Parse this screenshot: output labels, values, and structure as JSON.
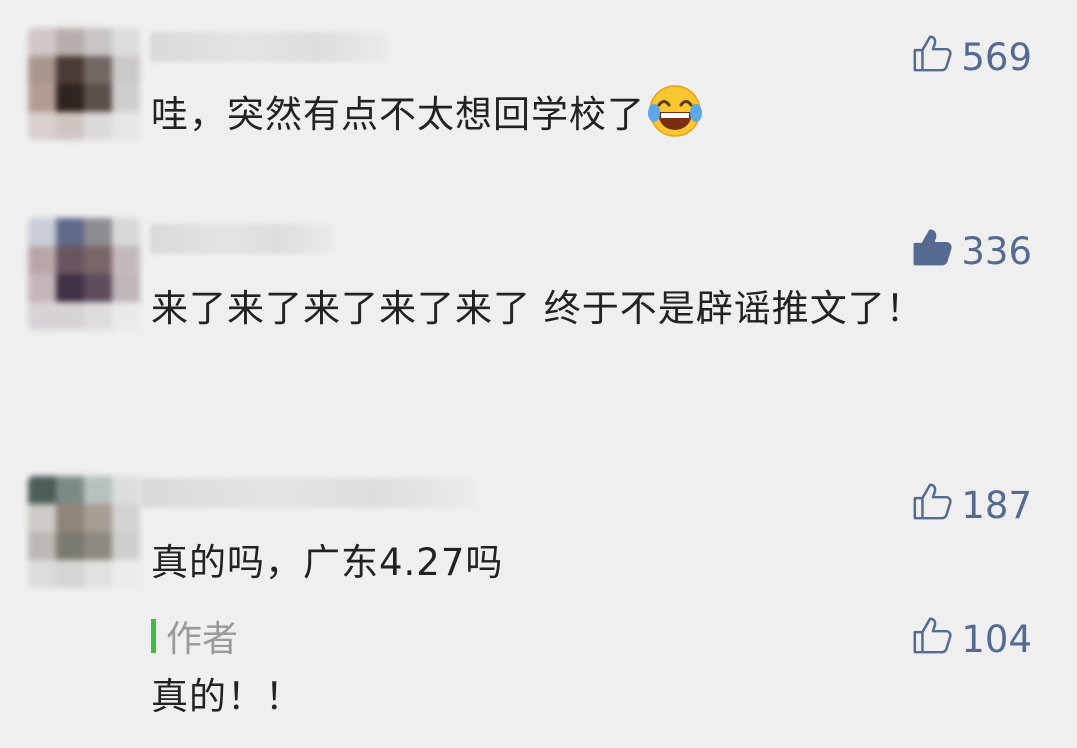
{
  "comments": [
    {
      "likes": "569",
      "liked": false,
      "text": "哇，突然有点不太想回学校了",
      "emoji": "laughing-with-tears-emoji"
    },
    {
      "likes": "336",
      "liked": true,
      "text": "来了来了来了来了来了 终于不是辟谣推文了！"
    },
    {
      "likes": "187",
      "liked": false,
      "text": "真的吗，广东4.27吗",
      "reply": {
        "author_label": "作者",
        "likes": "104",
        "liked": false,
        "text": "真的！！"
      }
    }
  ],
  "colors": {
    "background": "#efefef",
    "like_color": "#556a90",
    "author_bar": "#3dbf3d",
    "author_label": "#9a9a9a",
    "text": "#222222"
  },
  "icons": {
    "like": "thumbs-up-icon",
    "emoji": "laughing-with-tears-emoji"
  }
}
